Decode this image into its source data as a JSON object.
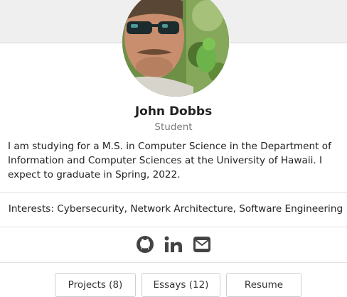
{
  "profile": {
    "name": "John Dobbs",
    "role": "Student",
    "bio": "I am studying for a M.S. in Computer Science in the Department of Information and Computer Sciences at the University of Hawaii. I expect to graduate in Spring, 2022.",
    "interests": "Interests: Cybersecurity, Network Architecture, Software Engineering"
  },
  "social": {
    "icons": [
      "github-icon",
      "linkedin-icon",
      "envelope-icon"
    ],
    "color": "#444444"
  },
  "tabs": {
    "projects": "Projects (8)",
    "essays": "Essays (12)",
    "resume": "Resume"
  }
}
